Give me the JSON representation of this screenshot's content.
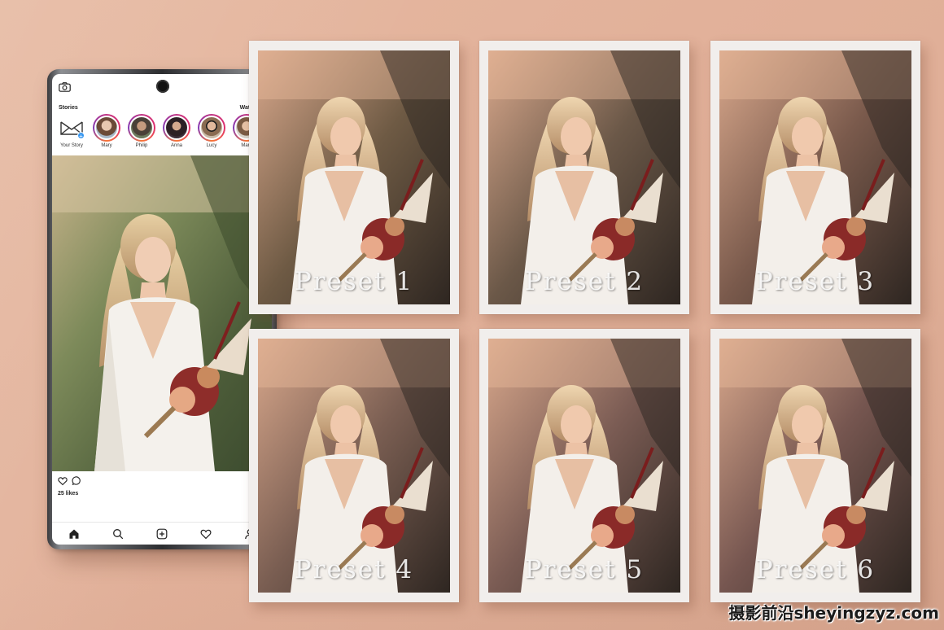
{
  "stories": {
    "title": "Stories",
    "watch_all": "Watch All",
    "items": [
      {
        "name": "Your Story"
      },
      {
        "name": "Mary"
      },
      {
        "name": "Philip"
      },
      {
        "name": "Anna"
      },
      {
        "name": "Lucy"
      },
      {
        "name": "Mark"
      }
    ]
  },
  "post": {
    "likes": "25 likes"
  },
  "presets": [
    {
      "label": "Preset 1",
      "tone": "#6e5a44"
    },
    {
      "label": "Preset 2",
      "tone": "#6b5848"
    },
    {
      "label": "Preset 3",
      "tone": "#7a5a4c"
    },
    {
      "label": "Preset 4",
      "tone": "#7a5e52"
    },
    {
      "label": "Preset 5",
      "tone": "#7b5c54"
    },
    {
      "label": "Preset 6",
      "tone": "#765650"
    }
  ],
  "watermark": "摄影前沿sheyingzyz.com",
  "icons": [
    "camera-icon",
    "add-user-icon",
    "heart-icon",
    "comment-icon",
    "bookmark-icon",
    "home-icon",
    "search-icon",
    "plus-square-icon",
    "heart-icon",
    "profile-icon"
  ],
  "colors": {
    "wall": "#e2b19a",
    "card": "#f1eeec",
    "story_ring": "#e1306c"
  }
}
